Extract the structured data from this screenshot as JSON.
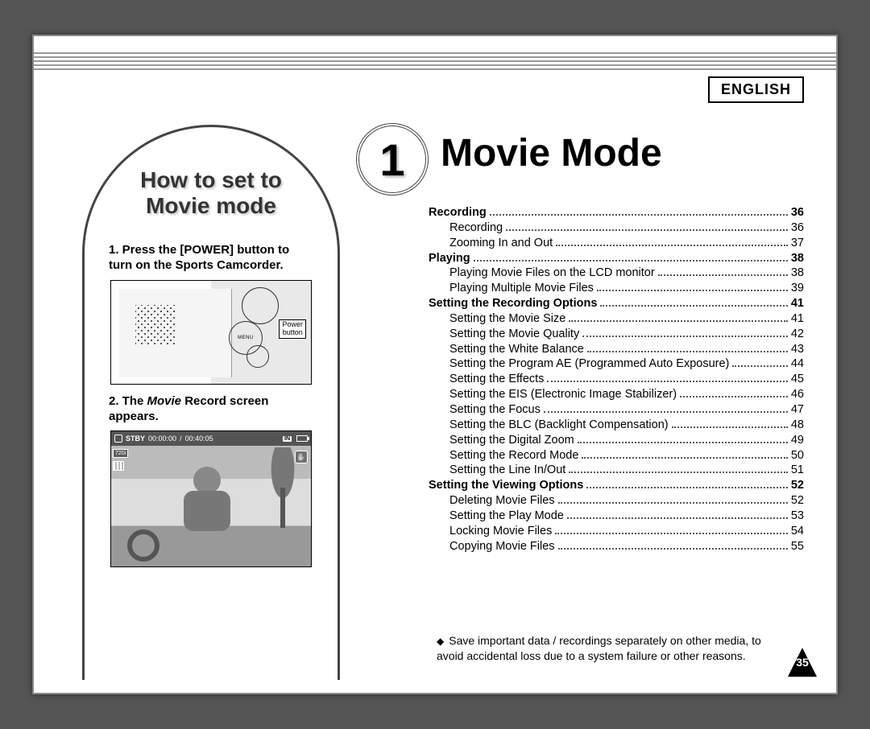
{
  "language_label": "ENGLISH",
  "chapter": {
    "number": "1",
    "title": "Movie Mode"
  },
  "arch": {
    "title_line1": "How to set to",
    "title_line2": "Movie mode",
    "step1": "1. Press the [POWER] button to turn on the Sports Camcorder.",
    "step2_pre": "2. The ",
    "step2_italic": "Movie",
    "step2_post": " Record screen appears.",
    "diagram_label_line1": "Power",
    "diagram_label_line2": "button",
    "lcd": {
      "status": "STBY",
      "time1": "00:00:00",
      "time2": "00:40:05",
      "in_badge": "IN",
      "res_badge": "720i"
    }
  },
  "toc": [
    {
      "type": "head",
      "label": "Recording",
      "page": "36"
    },
    {
      "type": "sub",
      "label": "Recording",
      "page": "36"
    },
    {
      "type": "sub",
      "label": "Zooming In and Out",
      "page": "37"
    },
    {
      "type": "head",
      "label": "Playing",
      "page": "38"
    },
    {
      "type": "sub",
      "label": "Playing Movie Files on the LCD monitor",
      "page": "38"
    },
    {
      "type": "sub",
      "label": "Playing Multiple Movie Files",
      "page": "39"
    },
    {
      "type": "head",
      "label": "Setting the Recording Options",
      "page": "41"
    },
    {
      "type": "sub",
      "label": "Setting the Movie Size",
      "page": "41"
    },
    {
      "type": "sub",
      "label": "Setting the Movie Quality",
      "page": "42"
    },
    {
      "type": "sub",
      "label": "Setting the White Balance",
      "page": "43"
    },
    {
      "type": "sub",
      "label": "Setting the Program AE (Programmed Auto Exposure)",
      "page": "44"
    },
    {
      "type": "sub",
      "label": "Setting the Effects",
      "page": "45"
    },
    {
      "type": "sub",
      "label": "Setting the EIS (Electronic Image Stabilizer)",
      "page": "46"
    },
    {
      "type": "sub",
      "label": "Setting the Focus",
      "page": "47"
    },
    {
      "type": "sub",
      "label": "Setting the BLC (Backlight Compensation)",
      "page": "48"
    },
    {
      "type": "sub",
      "label": "Setting the Digital Zoom",
      "page": "49"
    },
    {
      "type": "sub",
      "label": "Setting the Record Mode",
      "page": "50"
    },
    {
      "type": "sub",
      "label": "Setting the Line In/Out",
      "page": "51"
    },
    {
      "type": "head",
      "label": "Setting the Viewing Options",
      "page": "52"
    },
    {
      "type": "sub",
      "label": "Deleting Movie Files",
      "page": "52"
    },
    {
      "type": "sub",
      "label": "Setting the Play Mode",
      "page": "53"
    },
    {
      "type": "sub",
      "label": "Locking Movie Files",
      "page": "54"
    },
    {
      "type": "sub",
      "label": "Copying Movie Files",
      "page": "55"
    }
  ],
  "note": "Save important data / recordings separately on other media, to avoid accidental loss due to a system failure or other reasons.",
  "page_number": "35"
}
